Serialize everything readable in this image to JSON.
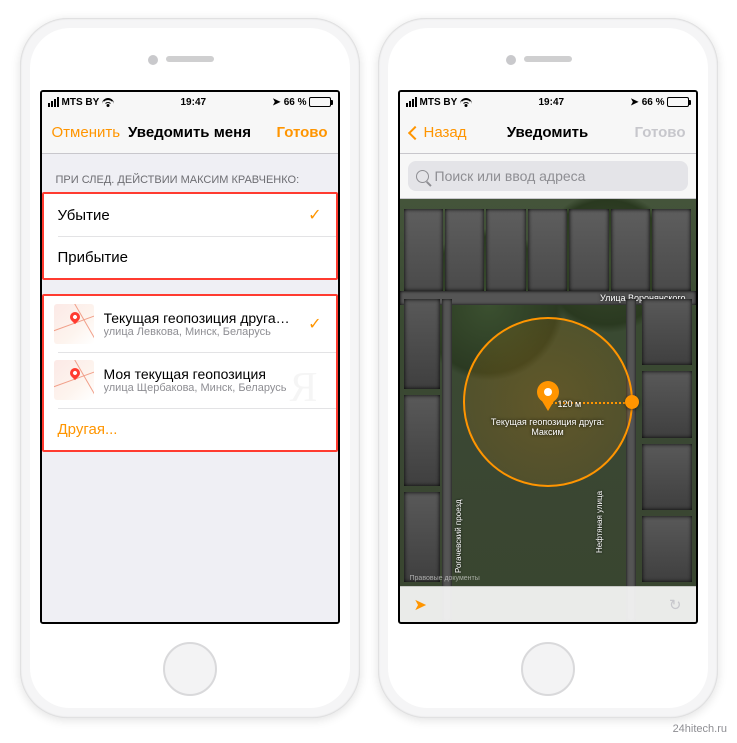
{
  "statusbar": {
    "carrier": "MTS BY",
    "time": "19:47",
    "battery_pct": "66 %"
  },
  "left": {
    "nav": {
      "cancel": "Отменить",
      "title": "Уведомить меня",
      "done": "Готово"
    },
    "section_header": "ПРИ СЛЕД. ДЕЙСТВИИ МАКСИМ КРАВЧЕНКО:",
    "options": {
      "leave": "Убытие",
      "arrive": "Прибытие"
    },
    "locations": [
      {
        "title": "Текущая геопозиция друга: Мак...",
        "sub": "улица Левкова, Минск, Беларусь",
        "checked": true
      },
      {
        "title": "Моя текущая геопозиция",
        "sub": "улица Щербакова, Минск, Беларусь",
        "checked": false
      }
    ],
    "other": "Другая..."
  },
  "right": {
    "nav": {
      "back": "Назад",
      "title": "Уведомить",
      "done": "Готово"
    },
    "search_placeholder": "Поиск или ввод адреса",
    "map": {
      "road_h": "Улица Воронянского",
      "road_v1": "Рогачевский проезд",
      "road_v2": "Нефтяная улица",
      "pin_label": "Текущая геопозиция друга: Максим",
      "radius": "120 м",
      "attrib": "Правовые документы"
    }
  },
  "watermark": "24hitech.ru"
}
